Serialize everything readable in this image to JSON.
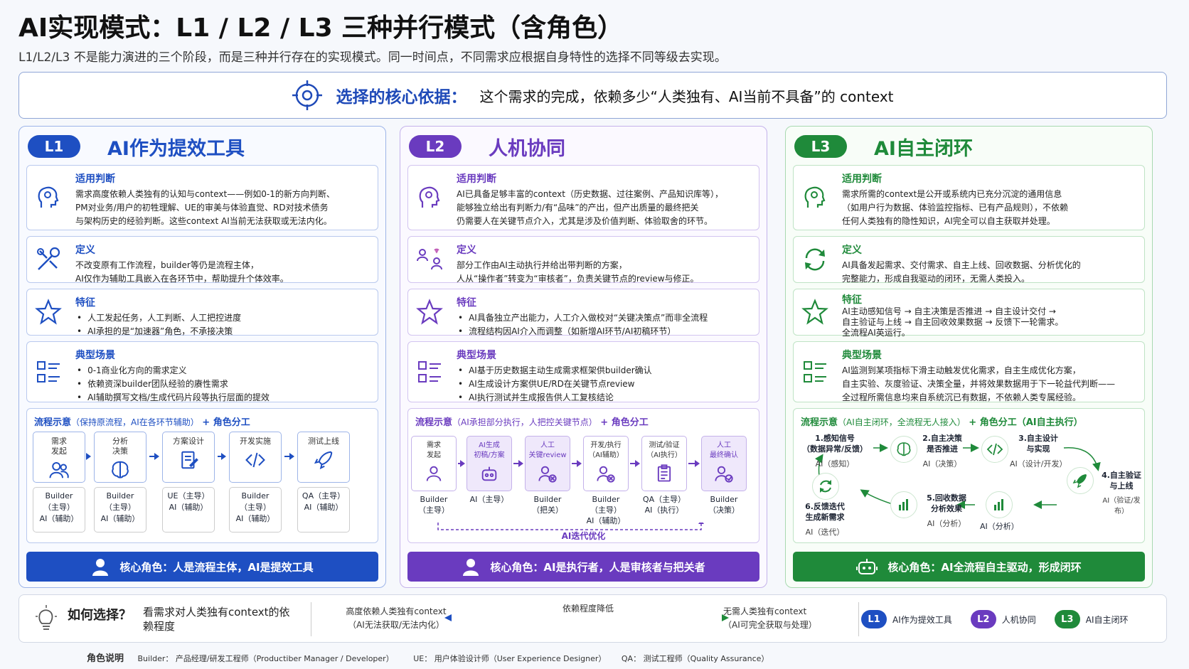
{
  "title": "AI实现模式：L1 / L2 / L3 三种并行模式（含角色）",
  "subtitle": "L1/L2/L3 不是能力演进的三个阶段，而是三种并行存在的实现模式。同一时间点，不同需求应根据自身特性的选择不同等级去实现。",
  "basis": {
    "label": "选择的核心依据：",
    "text": "这个需求的完成，依赖多少“人类独有、AI当前不具备”的 context",
    "icon": "target-icon"
  },
  "colors": {
    "l1": "#1e4fc2",
    "l2": "#6a3bbf",
    "l3": "#1f8a3a"
  },
  "l1": {
    "badge": "L1",
    "title": "AI作为提效工具",
    "judge": {
      "h": "适用判断",
      "lines": [
        "需求高度依赖人类独有的认知与context——例如0-1的新方向判断、",
        "PM对业务/用户的初牲理解、UE的审美与体验直觉、RD对技术债务",
        "与架构历史的经验判断。这些context AI当前无法获取或无法内化。"
      ]
    },
    "def": {
      "h": "定义",
      "lines": [
        "不改变原有工作流程，builder等仍是流程主体，",
        "AI仅作为辅助工具嵌入在各环节中，帮助提升个体效率。"
      ]
    },
    "feat": {
      "h": "特征",
      "items": [
        "人工发起任务，人工判断、人工把控进度",
        "AI承担的是“加速器”角色，不承接决策"
      ]
    },
    "scene": {
      "h": "典型场景",
      "items": [
        "0-1商业化方向的需求定义",
        "依赖资深builder团队经验的赓性需求",
        "AI辅助撰写文档/生成代码片段等执行层面的提效"
      ]
    },
    "flow": {
      "h": "流程示意",
      "sub": "（保持原流程，AI在各环节辅助）",
      "role": "+ 角色分工",
      "steps": [
        {
          "name": "需求\n发起",
          "role": "Builder\n（主导）\nAI（辅助）"
        },
        {
          "name": "分析\n决策",
          "role": "Builder\n（主导）\nAI（辅助）"
        },
        {
          "name": "方案设计",
          "role": "UE（主导）\nAI（辅助）"
        },
        {
          "name": "开发实施",
          "role": "Builder\n（主导）\nAI（辅助）"
        },
        {
          "name": "测试上线",
          "role": "QA（主导）\nAI（辅助）"
        }
      ]
    },
    "core": "核心角色：人是流程主体，AI是提效工具"
  },
  "l2": {
    "badge": "L2",
    "title": "人机协同",
    "judge": {
      "h": "适用判断",
      "lines": [
        "AI已具备足够丰富的context（历史数据、过往案例、产品知识库等），",
        "能够独立给出有判断力/有“品味”的产出，但产出质量的最终把关",
        "仍需要人在关键节点介入，尤其是涉及价值判断、体验取舍的环节。"
      ]
    },
    "def": {
      "h": "定义",
      "lines": [
        "部分工作由AI主动执行并给出带判断的方案，",
        "人从“操作者”转变为“审核者”，负责关键节点的review与修正。"
      ]
    },
    "feat": {
      "h": "特征",
      "items": [
        "AI具备独立产出能力，人工介入做校对“关键决策点”而非全流程",
        "流程结构因AI介入而调整（如新增AI环节/AI初稿环节）"
      ]
    },
    "scene": {
      "h": "典型场景",
      "items": [
        "AI基于历史数据主动生成需求框架供builder确认",
        "AI生成设计方案供UE/RD在关键节点review",
        "AI执行测试并生成报告供人工复核结论"
      ]
    },
    "flow": {
      "h": "流程示意",
      "sub": "（AI承担部分执行，人把控关键节点）",
      "role": "+ 角色分工",
      "steps": [
        {
          "name": "需求\n发起",
          "role": "Builder\n（主导）"
        },
        {
          "name": "AI生成\n初稿/方案",
          "role": "AI（主导）"
        },
        {
          "name": "人工\n关键review",
          "role": "Builder\n（把关）"
        },
        {
          "name": "开发/执行\n（AI辅助）",
          "role": "Builder\n（主导）\nAI（辅助）"
        },
        {
          "name": "测试/验证\n（AI执行）",
          "role": "QA（主导）\nAI（执行）"
        },
        {
          "name": "人工\n最终确认",
          "role": "Builder\n（决策）"
        }
      ],
      "loop": "AI迭代优化"
    },
    "core": "核心角色：AI是执行者，人是审核者与把关者"
  },
  "l3": {
    "badge": "L3",
    "title": "AI自主闭环",
    "judge": {
      "h": "适用判断",
      "lines": [
        "需求所需的context是公开或系统内已充分沉淀的通用信息",
        "（如用户行为数据、体验监控指标、已有产品规则），不依赖",
        "任何人类独有的隐性知识，AI完全可以自主获取并处理。"
      ]
    },
    "def": {
      "h": "定义",
      "lines": [
        "AI具备发起需求、交付需求、自主上线、回收数据、分析优化的",
        "完整能力，形成自我驱动的闭环，无需人类投入。"
      ]
    },
    "feat": {
      "h": "特征",
      "lines": [
        "AI主动感知信号 → 自主决策是否推进 → 自主设计交付 →",
        "自主验证与上线 → 自主回收效果数据 → 反馈下一轮需求。",
        "全流程AI英运行。"
      ]
    },
    "scene": {
      "h": "典型场景",
      "lines": [
        "AI监测到某项指标下滑主动触发优化需求，自主生成优化方案，",
        "自主实验、灰度验证、决策全量，并将效果数据用于下一轮益代判断——",
        "全过程所需信息均来自系统沉已有数据，不依赖人类专属经验。"
      ]
    },
    "flow": {
      "h": "流程示意",
      "sub": "（AI自主闭环，全流程无人接入）",
      "role": "+ 角色分工（AI自主执行）",
      "nodes": [
        {
          "name": "1.感知信号\n（数据异常/反馈）",
          "role": "AI（感知）"
        },
        {
          "name": "2.自主决策\n是否推进",
          "role": "AI（决策）"
        },
        {
          "name": "3.自主设计\n与实现",
          "role": "AI（设计/开发）"
        },
        {
          "name": "4.自主验证\n与上线",
          "role": "AI（验证/发布）"
        },
        {
          "name": "5.回收数据\n分析效果",
          "role": "AI（分析）"
        },
        {
          "name": "6.反馈迭代\n生成新需求",
          "role": "AI（迭代）"
        }
      ],
      "role_extra": "AI（分析）"
    },
    "core": "核心角色：AI全流程自主驱动，形成闭环"
  },
  "how": {
    "label": "如何选择？",
    "desc": "看需求对人类独有context的依\n赖程度",
    "left": "高度依赖人类独有context\n（AI无法获取/无法内化）",
    "mid": "依赖程度降低",
    "right": "无需人类独有context\n（AI可完全获取与处理）",
    "legend": [
      {
        "badge": "L1",
        "text": "AI作为提效工具"
      },
      {
        "badge": "L2",
        "text": "人机协同"
      },
      {
        "badge": "L3",
        "text": "AI自主闭环"
      }
    ]
  },
  "roles": {
    "label": "角色说明",
    "builder": "Builder： 产品经理/研发工程师（Productiber Manager   /   Developer）",
    "ue": "UE： 用户体验设计师（User Experience Designer）",
    "qa": "QA： 测试工程师（Quality Assurance）"
  }
}
